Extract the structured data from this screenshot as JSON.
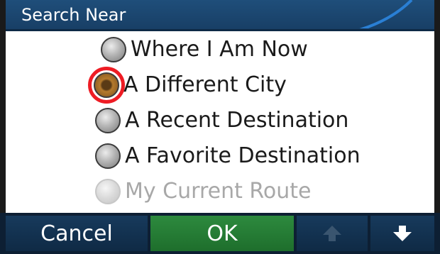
{
  "dialog": {
    "title": "Search Near"
  },
  "options": [
    {
      "label": "Where I Am Now",
      "state": "unselected"
    },
    {
      "label": "A Different City",
      "state": "selected"
    },
    {
      "label": "A Recent Destination",
      "state": "unselected"
    },
    {
      "label": "A Favorite Destination",
      "state": "unselected"
    },
    {
      "label": "My Current Route",
      "state": "disabled"
    }
  ],
  "buttons": {
    "cancel": "Cancel",
    "ok": "OK",
    "up_icon": "up-arrow-icon",
    "down_icon": "down-arrow-icon",
    "up_enabled": false,
    "down_enabled": true
  },
  "colors": {
    "title_bar": "#1f4e7a",
    "ok_button": "#2d8a3e",
    "highlight_ring": "#ee1c24",
    "disabled_text": "#a8a8a8"
  }
}
